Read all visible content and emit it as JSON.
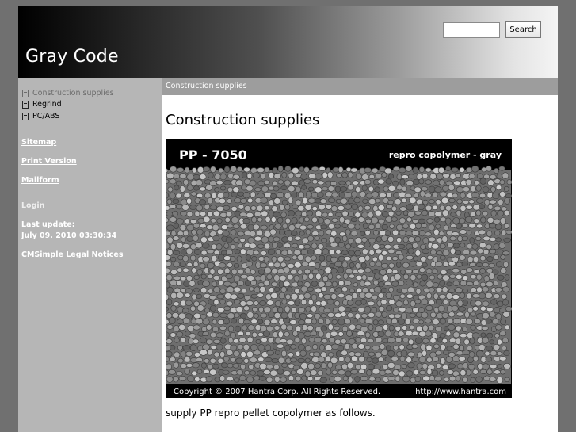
{
  "header": {
    "site_title": "Gray Code",
    "search_placeholder": "",
    "search_button_label": "Search"
  },
  "sidebar": {
    "nav_items": [
      {
        "label": "Construction supplies",
        "current": true
      },
      {
        "label": "Regrind",
        "current": false
      },
      {
        "label": "PC/ABS",
        "current": false
      }
    ],
    "links": {
      "sitemap": "Sitemap",
      "print_version": "Print Version",
      "mailform": "Mailform"
    },
    "login_label": "Login",
    "last_update_label": "Last update:",
    "last_update_value": "July 09. 2010 03:30:34",
    "legal_link": "CMSimple Legal Notices"
  },
  "breadcrumb": "Construction supplies",
  "content": {
    "heading": "Construction supplies",
    "image": {
      "product_code": "PP - 7050",
      "product_description": "repro copolymer - gray",
      "copyright": "Copyright © 2007 Hantra Corp. All Rights Reserved.",
      "url": "http://www.hantra.com"
    },
    "paragraph": "supply PP repro pellet copolymer as follows."
  },
  "colors": {
    "page_background": "#707070",
    "sidebar": "#b6b6b6",
    "breadcrumb_bar": "#9d9d9d",
    "image_banner": "#000000"
  }
}
